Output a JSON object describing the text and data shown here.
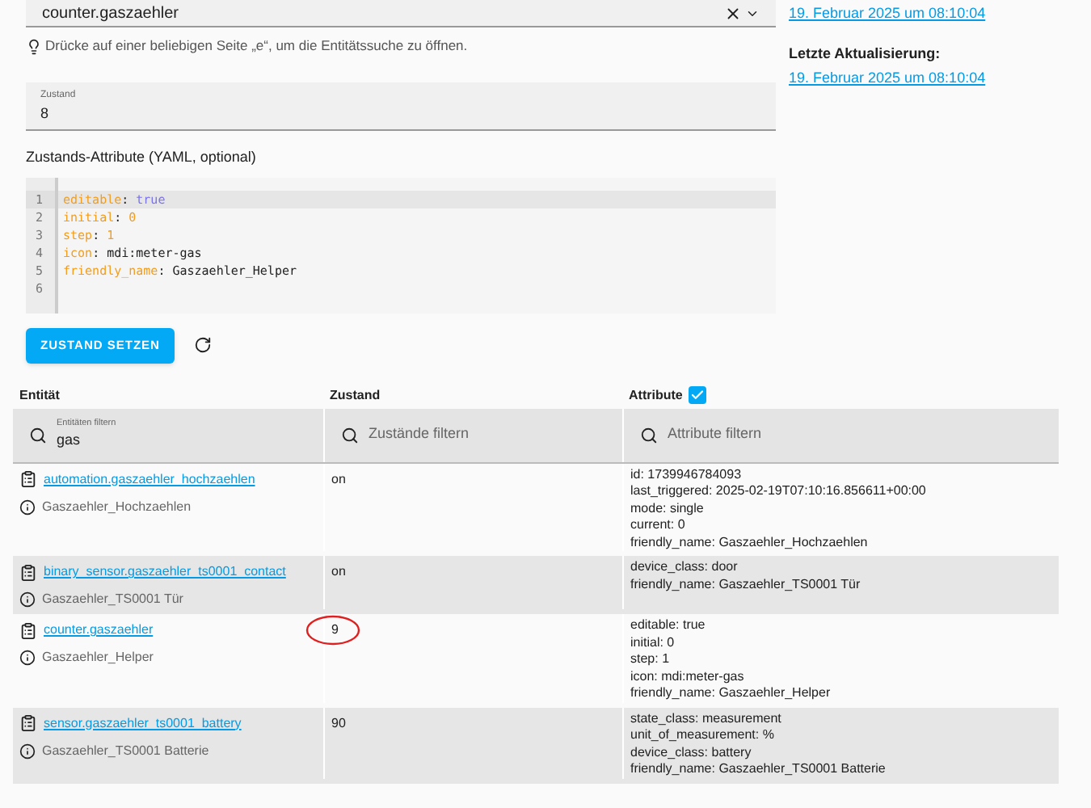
{
  "entity_field": {
    "value": "counter.gaszaehler"
  },
  "hint": "Drücke auf einer beliebigen Seite „e“, um die Entitätssuche zu öffnen.",
  "state_field": {
    "label": "Zustand",
    "value": "8"
  },
  "attributes_label": "Zustands-Attribute (YAML, optional)",
  "editor": {
    "lines": [
      {
        "number": "1",
        "selected": true,
        "tokens": [
          {
            "text": "editable",
            "kind": "key"
          },
          {
            "text": ": ",
            "kind": "plain"
          },
          {
            "text": "true",
            "kind": "bool"
          }
        ]
      },
      {
        "number": "2",
        "selected": false,
        "tokens": [
          {
            "text": "initial",
            "kind": "key"
          },
          {
            "text": ": ",
            "kind": "plain"
          },
          {
            "text": "0",
            "kind": "number"
          }
        ]
      },
      {
        "number": "3",
        "selected": false,
        "tokens": [
          {
            "text": "step",
            "kind": "key"
          },
          {
            "text": ": ",
            "kind": "plain"
          },
          {
            "text": "1",
            "kind": "number"
          }
        ]
      },
      {
        "number": "4",
        "selected": false,
        "tokens": [
          {
            "text": "icon",
            "kind": "key"
          },
          {
            "text": ": mdi:meter-gas",
            "kind": "plain"
          }
        ]
      },
      {
        "number": "5",
        "selected": false,
        "tokens": [
          {
            "text": "friendly_name",
            "kind": "key"
          },
          {
            "text": ": Gaszaehler_Helper",
            "kind": "plain"
          }
        ]
      },
      {
        "number": "6",
        "selected": false
      }
    ]
  },
  "set_state_button": "ZUSTAND SETZEN",
  "info": [
    {
      "label": "Letzte Aktualisierung:",
      "value": "19. Februar 2025 um 08:10:04"
    }
  ],
  "info_top_link": "19. Februar 2025 um 08:10:04",
  "table": {
    "columns": [
      "Entität",
      "Zustand",
      "Attribute"
    ],
    "attributes_checked": true,
    "filters": [
      {
        "label": "Entitäten filtern",
        "value": "gas"
      },
      {
        "placeholder": "Zustände filtern"
      },
      {
        "placeholder": "Attribute filtern"
      }
    ],
    "rows": [
      {
        "entity": "automation.gaszaehler_hochzaehlen",
        "name": "Gaszaehler_Hochzaehlen",
        "state": "on",
        "circled": false,
        "attributes": [
          "id: 1739946784093",
          "last_triggered: 2025-02-19T07:10:16.856611+00:00",
          "mode: single",
          "current: 0",
          "friendly_name: Gaszaehler_Hochzaehlen"
        ]
      },
      {
        "entity": "binary_sensor.gaszaehler_ts0001_contact",
        "name": "Gaszaehler_TS0001 Tür",
        "state": "on",
        "circled": false,
        "attributes": [
          "device_class: door",
          "friendly_name: Gaszaehler_TS0001 Tür"
        ]
      },
      {
        "entity": "counter.gaszaehler",
        "name": "Gaszaehler_Helper",
        "state": "9",
        "circled": true,
        "attributes": [
          "editable: true",
          "initial: 0",
          "step: 1",
          "icon: mdi:meter-gas",
          "friendly_name: Gaszaehler_Helper"
        ]
      },
      {
        "entity": "sensor.gaszaehler_ts0001_battery",
        "name": "Gaszaehler_TS0001 Batterie",
        "state": "90",
        "circled": false,
        "attributes": [
          "state_class: measurement",
          "unit_of_measurement: %",
          "device_class: battery",
          "friendly_name: Gaszaehler_TS0001 Batterie"
        ]
      }
    ]
  }
}
